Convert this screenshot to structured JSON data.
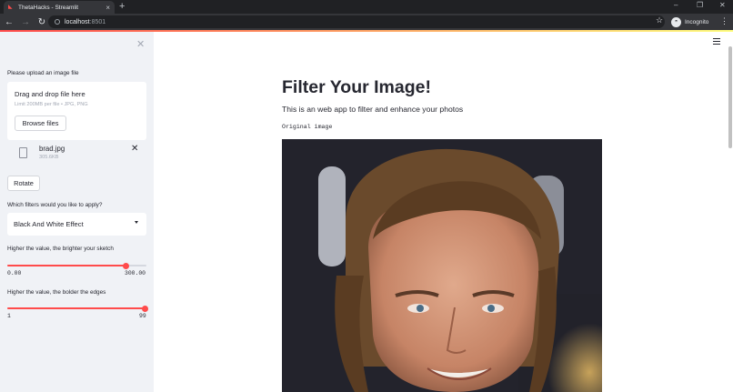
{
  "browser": {
    "tab_title": "ThetaHacks - Streamlit",
    "url_host": "localhost",
    "url_port": ":8501",
    "profile_label": "Incognito"
  },
  "sidebar": {
    "upload_label": "Please upload an image file",
    "dropzone_title": "Drag and drop file here",
    "dropzone_limit": "Limit 200MB per file • JPG, PNG",
    "browse_label": "Browse files",
    "file": {
      "name": "brad.jpg",
      "size": "305.6KB"
    },
    "rotate_label": "Rotate",
    "filter_label": "Which filters would you like to apply?",
    "filter_value": "Black And White Effect",
    "slider1": {
      "label": "Higher the value, the brighter your sketch",
      "min": "0.00",
      "max": "300.00",
      "fraction": 0.85
    },
    "slider2": {
      "label": "Higher the value, the bolder the edges",
      "min": "1",
      "max": "99",
      "fraction": 0.99
    }
  },
  "main": {
    "title": "Filter Your Image!",
    "description": "This is an web app to filter and enhance your photos",
    "image_caption": "Original image"
  },
  "colors": {
    "accent": "#ff4b4b",
    "sidebar_bg": "#f0f2f6",
    "chrome_bg": "#35363a"
  },
  "icons": [
    "streamlit-favicon",
    "close-icon",
    "file-icon",
    "hamburger-menu-icon",
    "incognito-icon",
    "star-icon"
  ]
}
